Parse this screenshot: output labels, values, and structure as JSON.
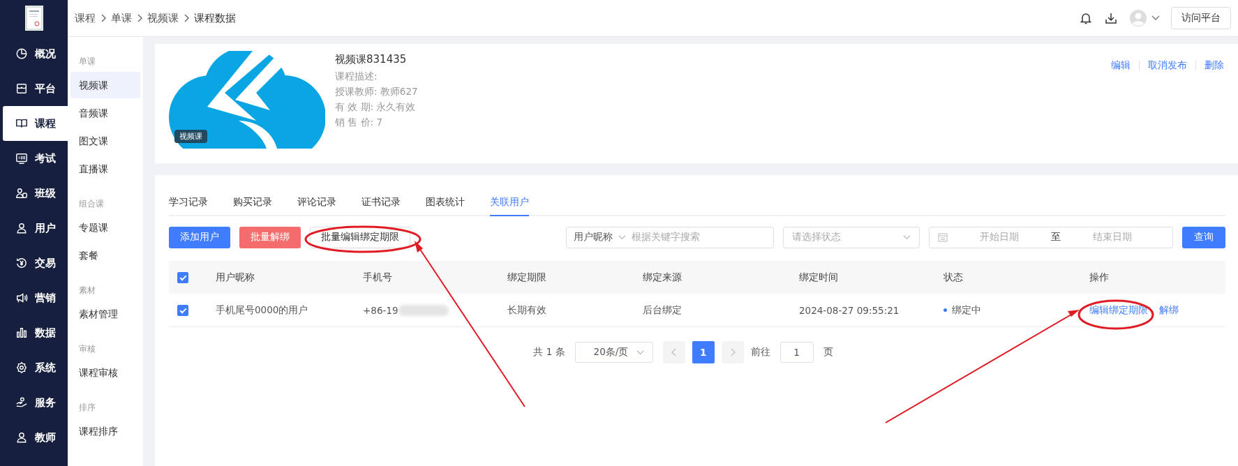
{
  "nav": [
    {
      "label": "概况",
      "selected": false
    },
    {
      "label": "平台",
      "selected": false
    },
    {
      "label": "课程",
      "selected": true
    },
    {
      "label": "考试",
      "selected": false
    },
    {
      "label": "班级",
      "selected": false
    },
    {
      "label": "用户",
      "selected": false
    },
    {
      "label": "交易",
      "selected": false
    },
    {
      "label": "营销",
      "selected": false
    },
    {
      "label": "数据",
      "selected": false
    },
    {
      "label": "系统",
      "selected": false
    },
    {
      "label": "服务",
      "selected": false
    },
    {
      "label": "教师",
      "selected": false
    }
  ],
  "subnav": [
    {
      "group": "单课",
      "items": [
        {
          "label": "视频课",
          "selected": true
        },
        {
          "label": "音频课",
          "selected": false
        },
        {
          "label": "图文课",
          "selected": false
        },
        {
          "label": "直播课",
          "selected": false
        }
      ]
    },
    {
      "group": "组合课",
      "items": [
        {
          "label": "专题课",
          "selected": false
        },
        {
          "label": "套餐",
          "selected": false
        }
      ]
    },
    {
      "group": "素材",
      "items": [
        {
          "label": "素材管理",
          "selected": false
        }
      ]
    },
    {
      "group": "审核",
      "items": [
        {
          "label": "课程审核",
          "selected": false
        }
      ]
    },
    {
      "group": "排序",
      "items": [
        {
          "label": "课程排序",
          "selected": false
        }
      ]
    }
  ],
  "breadcrumb": [
    "课程",
    "单课",
    "视频课",
    "课程数据"
  ],
  "header": {
    "visit_button": "访问平台"
  },
  "course": {
    "badge": "视频课",
    "title": "视频课831435",
    "fields": [
      {
        "label": "课程描述:"
      },
      {
        "label": "授课教师:",
        "value": "教师627"
      },
      {
        "label": "有 效 期:",
        "value": "永久有效"
      },
      {
        "label": "销 售 价:",
        "value": "7"
      }
    ],
    "actions": [
      "编辑",
      "取消发布",
      "删除"
    ]
  },
  "tabs": [
    {
      "label": "学习记录",
      "selected": false
    },
    {
      "label": "购买记录",
      "selected": false
    },
    {
      "label": "评论记录",
      "selected": false
    },
    {
      "label": "证书记录",
      "selected": false
    },
    {
      "label": "图表统计",
      "selected": false
    },
    {
      "label": "关联用户",
      "selected": true
    }
  ],
  "toolbar": [
    {
      "label": "添加用户",
      "kind": "primary"
    },
    {
      "label": "批量解绑",
      "kind": "danger"
    },
    {
      "label": "批量编辑绑定期限",
      "kind": "plain"
    }
  ],
  "filters": {
    "search_field": "用户昵称",
    "search_placeholder": "根据关键字搜索",
    "status_placeholder": "请选择状态",
    "start_placeholder": "开始日期",
    "range_separator": "至",
    "end_placeholder": "结束日期",
    "query_button": "查询"
  },
  "table": {
    "header_checked": true,
    "columns": [
      "用户昵称",
      "手机号",
      "绑定期限",
      "绑定来源",
      "绑定时间",
      "状态",
      "操作"
    ],
    "rows": [
      {
        "checked": true,
        "nickname": "手机尾号0000的用户",
        "phone": "+86-19",
        "period": "长期有效",
        "source": "后台绑定",
        "time": "2024-08-27 09:55:21",
        "status": "绑定中",
        "color": "#3b7cff",
        "actions": [
          "编辑绑定期限",
          "解绑"
        ]
      }
    ]
  },
  "pagination": {
    "total": "共 1 条",
    "page_size": "20条/页",
    "pages": [
      {
        "label": "1",
        "selected": true
      }
    ],
    "goto_label": "前往",
    "goto_value": "1",
    "goto_suffix": "页"
  }
}
